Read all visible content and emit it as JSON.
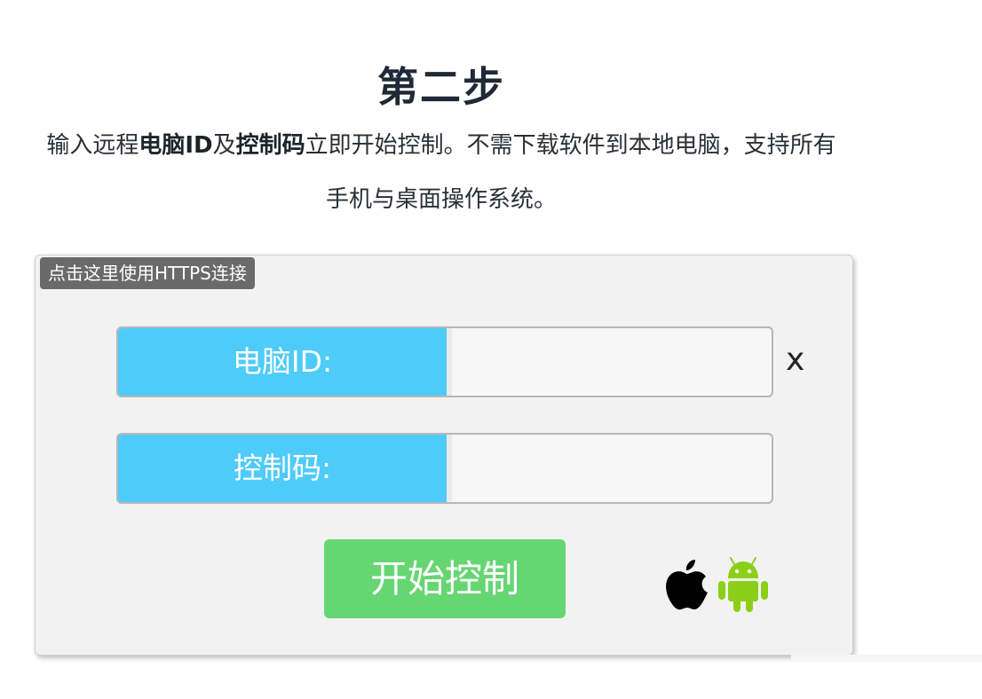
{
  "header": {
    "step_title": "第二步",
    "intro_part1": "输入远程",
    "intro_bold1": "电脑ID",
    "intro_part2": "及",
    "intro_bold2": "控制码",
    "intro_part3": "立即开始控制。不需下载软件到本地电脑，支持所有手机与桌面操作系统。"
  },
  "panel": {
    "https_link": "点击这里使用HTTPS连接",
    "computer_id": {
      "label": "电脑ID:",
      "value": "",
      "clear_label": "x"
    },
    "control_code": {
      "label": "控制码:",
      "value": ""
    },
    "start_button": "开始控制",
    "platform_icons": [
      "apple-icon",
      "android-icon"
    ],
    "colors": {
      "label_bg": "#4fcbf9",
      "button_bg": "#66d673",
      "android": "#8ccf18",
      "https_bg": "#6a6a6a"
    }
  }
}
